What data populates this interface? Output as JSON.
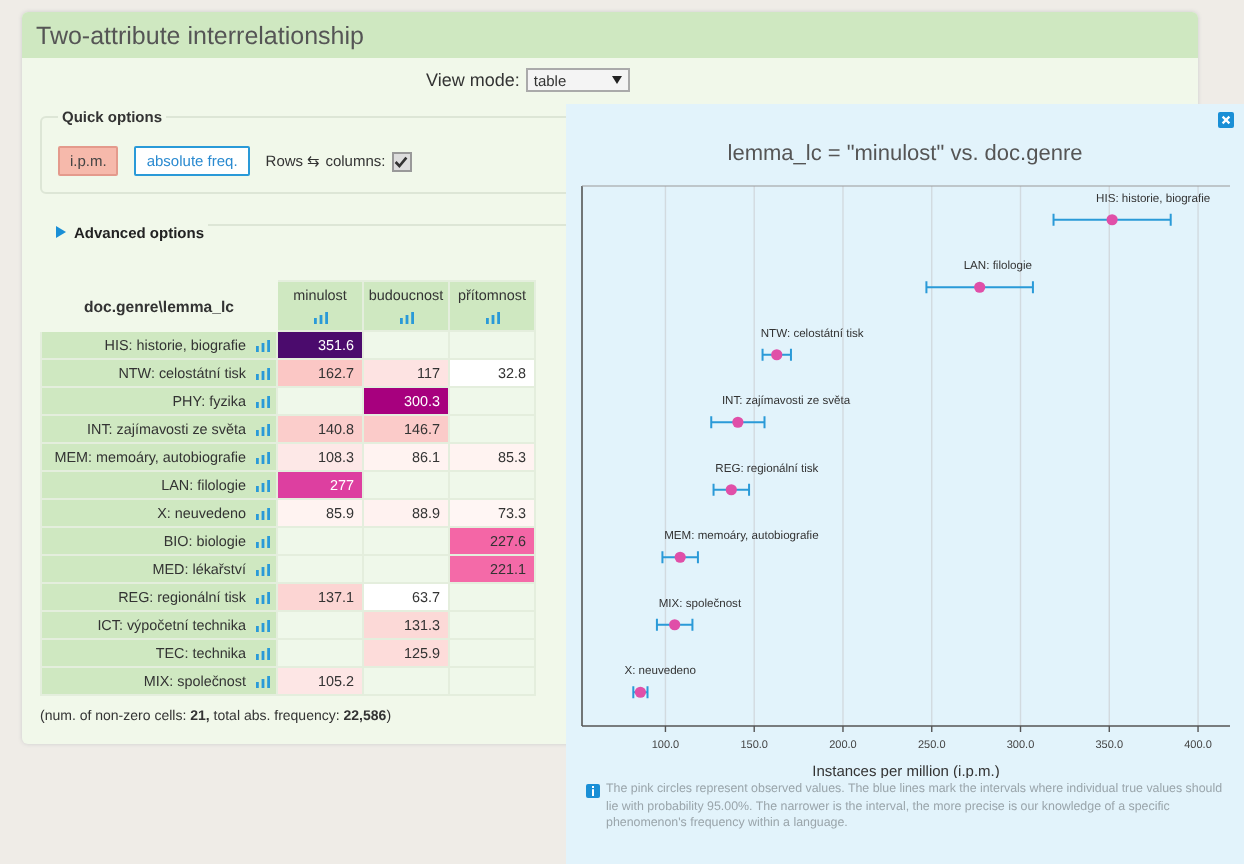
{
  "panel": {
    "title": "Two-attribute interrelationship"
  },
  "view_mode": {
    "label": "View mode:",
    "value": "table"
  },
  "quick_options": {
    "legend": "Quick options",
    "buttons": [
      {
        "label": "i.p.m.",
        "selected": true
      },
      {
        "label": "absolute freq.",
        "selected": false
      }
    ],
    "swap": {
      "label": "Rows ⇆ columns:",
      "checked": true
    }
  },
  "advanced_options": {
    "label": "Advanced options",
    "expanded": false
  },
  "table": {
    "corner": "doc.genre\\lemma_lc",
    "columns": [
      "minulost",
      "budoucnost",
      "přítomnost"
    ],
    "rows": [
      {
        "label": "HIS: historie, biografie",
        "cells": [
          {
            "value": "351.6",
            "color": "#4b0b6d"
          },
          null,
          null
        ]
      },
      {
        "label": "NTW: celostátní tisk",
        "cells": [
          {
            "value": "162.7",
            "color": "#fbc7c5"
          },
          {
            "value": "117",
            "color": "#fde3e2"
          },
          {
            "value": "32.8",
            "color": "#ffffff"
          }
        ]
      },
      {
        "label": "PHY: fyzika",
        "cells": [
          null,
          {
            "value": "300.3",
            "color": "#a7007e"
          },
          null
        ]
      },
      {
        "label": "INT: zajímavosti ze světa",
        "cells": [
          {
            "value": "140.8",
            "color": "#fbcdcb"
          },
          {
            "value": "146.7",
            "color": "#fbcbc9"
          },
          null
        ]
      },
      {
        "label": "MEM: memoáry, autobiografie",
        "cells": [
          {
            "value": "108.3",
            "color": "#fde8e7"
          },
          {
            "value": "86.1",
            "color": "#fff3f1"
          },
          {
            "value": "85.3",
            "color": "#fff3f1"
          }
        ]
      },
      {
        "label": "LAN: filologie",
        "cells": [
          {
            "value": "277",
            "color": "#dd3fa0"
          },
          null,
          null
        ]
      },
      {
        "label": "X: neuvedeno",
        "cells": [
          {
            "value": "85.9",
            "color": "#fff3f1"
          },
          {
            "value": "88.9",
            "color": "#fff2f0"
          },
          {
            "value": "73.3",
            "color": "#fff6f4"
          }
        ]
      },
      {
        "label": "BIO: biologie",
        "cells": [
          null,
          null,
          {
            "value": "227.6",
            "color": "#f466a6"
          }
        ]
      },
      {
        "label": "MED: lékařství",
        "cells": [
          null,
          null,
          {
            "value": "221.1",
            "color": "#f46aa8"
          }
        ]
      },
      {
        "label": "REG: regionální tisk",
        "cells": [
          {
            "value": "137.1",
            "color": "#fcd5d3"
          },
          {
            "value": "63.7",
            "color": "#ffffff"
          },
          null
        ]
      },
      {
        "label": "ICT: výpočetní technika",
        "cells": [
          null,
          {
            "value": "131.3",
            "color": "#fcd9d7"
          },
          null
        ]
      },
      {
        "label": "TEC: technika",
        "cells": [
          null,
          {
            "value": "125.9",
            "color": "#fddcda"
          },
          null
        ]
      },
      {
        "label": "MIX: společnost",
        "cells": [
          {
            "value": "105.2",
            "color": "#fde6e5"
          },
          null,
          null
        ]
      }
    ]
  },
  "summary": "(num. of non-zero cells: **21,** total abs. frequency: **22,586**)",
  "chart_panel": {
    "chart_data": {
      "type": "scatter",
      "title": "lemma_lc = \"minulost\" vs. doc.genre",
      "xlabel": "Instances per million (i.p.m.)",
      "orientation": "horizontal",
      "categories": [
        null,
        null,
        null,
        null,
        null,
        null,
        null,
        null
      ],
      "grid": true,
      "series": [
        {
          "color": "#e04fa8",
          "values": [
            351.6,
            277,
            162.7,
            140.8,
            137.1,
            108.3,
            105.2,
            85.9
          ],
          "errors": [
            33,
            30,
            8,
            15,
            10,
            10,
            10,
            4
          ]
        }
      ],
      "annotations": [
        {
          "text": "HIS: historie, biografie"
        },
        {
          "text": "LAN: filologie"
        },
        {
          "text": "NTW: celostátní tisk"
        },
        {
          "text": "INT: zajímavosti ze světa"
        },
        {
          "text": "REG: regionální tisk"
        },
        {
          "text": "MEM: memoáry, autobiografie"
        },
        {
          "text": "MIX: společnost"
        },
        {
          "text": "X: neuvedeno"
        }
      ],
      "xlim": [
        53,
        418
      ],
      "xticks": [
        {
          "value": 100,
          "label": "100.0"
        },
        {
          "value": 150,
          "label": "150.0"
        },
        {
          "value": 200,
          "label": "200.0"
        },
        {
          "value": 250,
          "label": "250.0"
        },
        {
          "value": 300,
          "label": "300.0"
        },
        {
          "value": 350,
          "label": "350.0"
        },
        {
          "value": 400,
          "label": "400.0"
        }
      ]
    },
    "note": "The pink circles represent observed values. The blue lines mark the intervals where individual true values should lie with probability 95.00%. The narrower is the interval, the more precise is our knowledge of a specific phenomenon's frequency within a language."
  }
}
